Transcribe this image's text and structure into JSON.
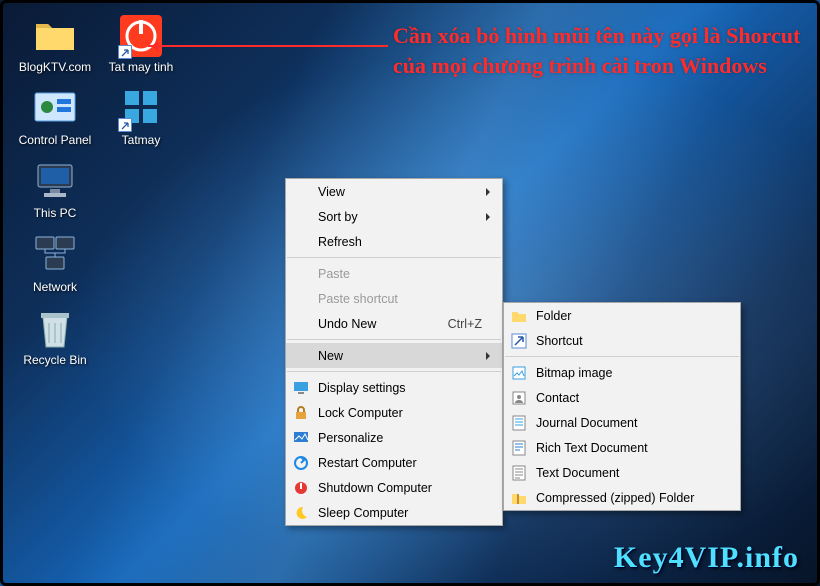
{
  "annotation": {
    "text": "Cần xóa bỏ hình mũi tên này gọi là Shorcut của mọi chương trình cài tron Windows"
  },
  "desktop": {
    "icons": [
      {
        "name": "BlogKTV.com",
        "kind": "folder"
      },
      {
        "name": "Tat may tinh",
        "kind": "power-shortcut"
      },
      {
        "name": "Control Panel",
        "kind": "control-panel"
      },
      {
        "name": "Tatmay",
        "kind": "tile-shortcut"
      },
      {
        "name": "This PC",
        "kind": "this-pc"
      },
      {
        "name": "Network",
        "kind": "network"
      },
      {
        "name": "Recycle Bin",
        "kind": "recycle-bin"
      }
    ]
  },
  "context_menu": {
    "items": [
      {
        "label": "View",
        "submenu": true
      },
      {
        "label": "Sort by",
        "submenu": true
      },
      {
        "label": "Refresh"
      },
      {
        "sep": true
      },
      {
        "label": "Paste",
        "disabled": true
      },
      {
        "label": "Paste shortcut",
        "disabled": true
      },
      {
        "label": "Undo New",
        "shortcut": "Ctrl+Z"
      },
      {
        "sep": true
      },
      {
        "label": "New",
        "submenu": true,
        "hover": true
      },
      {
        "sep": true
      },
      {
        "label": "Display settings",
        "icon": "display-icon"
      },
      {
        "label": "Lock Computer",
        "icon": "lock-icon"
      },
      {
        "label": "Personalize",
        "icon": "personalize-icon"
      },
      {
        "label": "Restart Computer",
        "icon": "restart-icon"
      },
      {
        "label": "Shutdown Computer",
        "icon": "shutdown-icon"
      },
      {
        "label": "Sleep Computer",
        "icon": "sleep-icon"
      }
    ]
  },
  "new_submenu": {
    "items": [
      {
        "label": "Folder",
        "icon": "folder-icon"
      },
      {
        "label": "Shortcut",
        "icon": "shortcut-icon"
      },
      {
        "sep": true
      },
      {
        "label": "Bitmap image",
        "icon": "bitmap-icon"
      },
      {
        "label": "Contact",
        "icon": "contact-icon"
      },
      {
        "label": "Journal Document",
        "icon": "journal-icon"
      },
      {
        "label": "Rich Text Document",
        "icon": "rtf-icon"
      },
      {
        "label": "Text Document",
        "icon": "text-icon"
      },
      {
        "label": "Compressed (zipped) Folder",
        "icon": "zip-icon"
      }
    ]
  },
  "watermark": {
    "text": "Key4VIP.info"
  }
}
